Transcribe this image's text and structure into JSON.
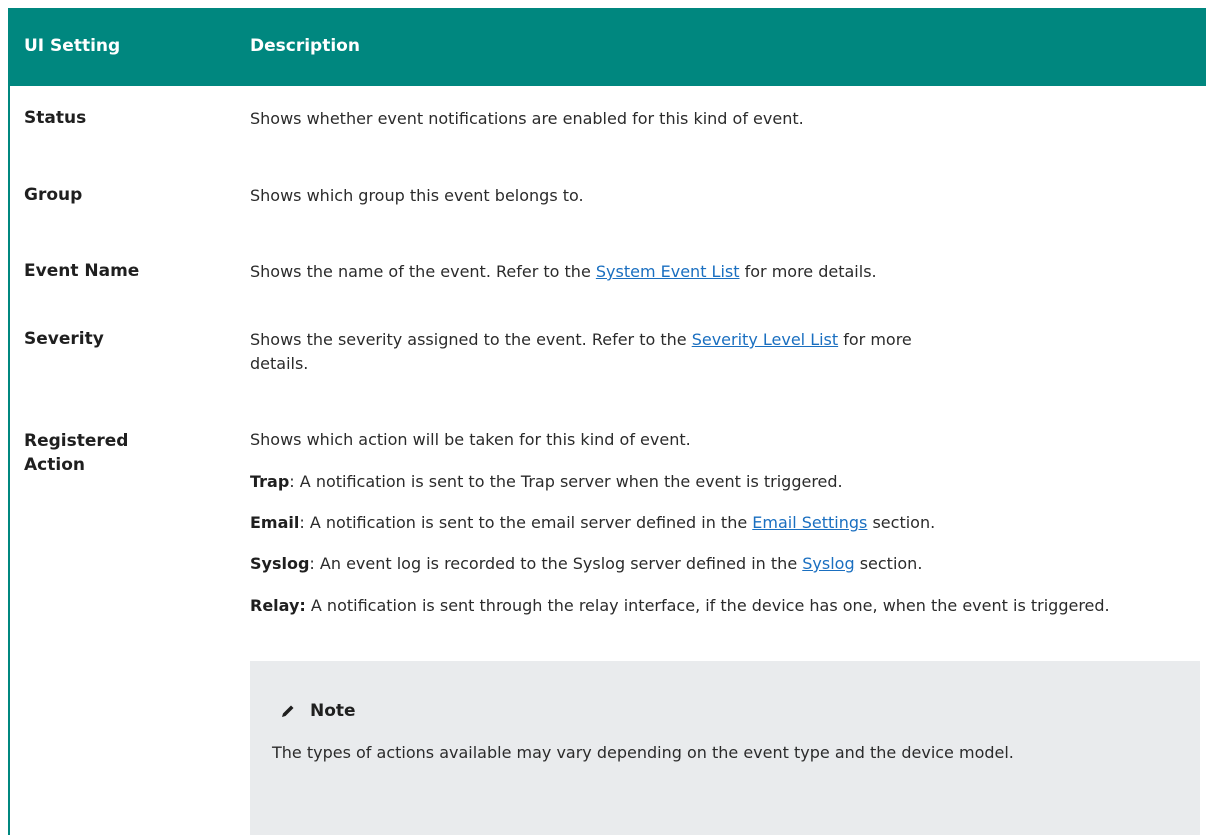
{
  "header": {
    "col1": "UI Setting",
    "col2": "Description"
  },
  "rows": [
    {
      "label": "Status",
      "desc": "Shows whether event notifications are enabled for this kind of event."
    },
    {
      "label": "Group",
      "desc": "Shows which group this event belongs to."
    },
    {
      "label": "Event Name",
      "pre": "Shows the name of the event. Refer to the ",
      "link": "System Event List",
      "post": " for more details."
    },
    {
      "label": "Severity",
      "pre": "Shows the severity assigned to the event. Refer to the ",
      "link": "Severity Level List",
      "post": " for more details."
    },
    {
      "label": "Registered Action",
      "desc": "Shows which action will be taken for this kind of event."
    }
  ],
  "actions": [
    {
      "term": "Trap",
      "sep": ": ",
      "text": "A notification is sent to the Trap server when the event is triggered."
    },
    {
      "term": "Email",
      "sep": ": ",
      "pre": "A notification is sent to the email server defined in the ",
      "link": "Email Settings",
      "post": " section."
    },
    {
      "term": "Syslog",
      "sep": ": ",
      "pre": "An event log is recorded to the Syslog server defined in the ",
      "link": "Syslog",
      "post": " section."
    },
    {
      "term": "Relay:",
      "sep": " ",
      "text": "A notification is sent through the relay interface, if the device has one, when the event is triggered."
    }
  ],
  "note": {
    "title": "Note",
    "icon": "pencil-icon",
    "body": "The types of actions available may vary depending on the event type and the device model."
  }
}
